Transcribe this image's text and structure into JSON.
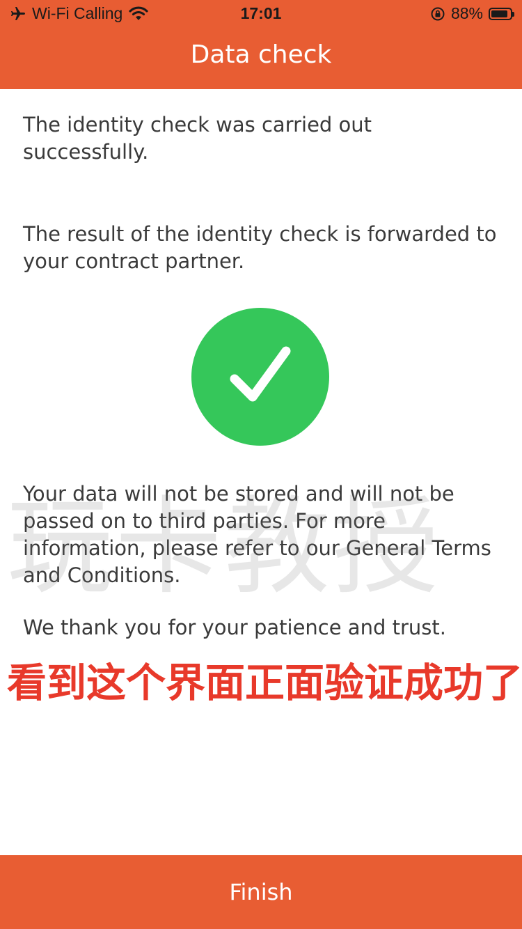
{
  "status_bar": {
    "carrier": "Wi-Fi Calling",
    "time": "17:01",
    "battery_percent_label": "88%",
    "battery_level": 0.88,
    "icons": [
      "airplane-icon",
      "wifi-icon",
      "orientation-lock-icon",
      "battery-icon"
    ]
  },
  "header": {
    "title": "Data check"
  },
  "content": {
    "success_text": "The identity check was carried out successfully.",
    "forward_text": "The result of the identity check is forwarded to your contract partner.",
    "privacy_text": "Your data will not be stored and will not be passed on to third parties. For more information, please refer to our General Terms and Conditions.",
    "thanks_text": "We thank you for your patience and trust."
  },
  "status_icon": "checkmark-icon",
  "overlay": {
    "watermark": "玩卡教授",
    "banner": "看到这个界面正面验证成功了"
  },
  "footer": {
    "finish_label": "Finish"
  },
  "colors": {
    "brand_orange": "#E85D33",
    "success_green": "#35C75A",
    "banner_red": "#E8392A",
    "text_gray": "#3a3a3a"
  }
}
